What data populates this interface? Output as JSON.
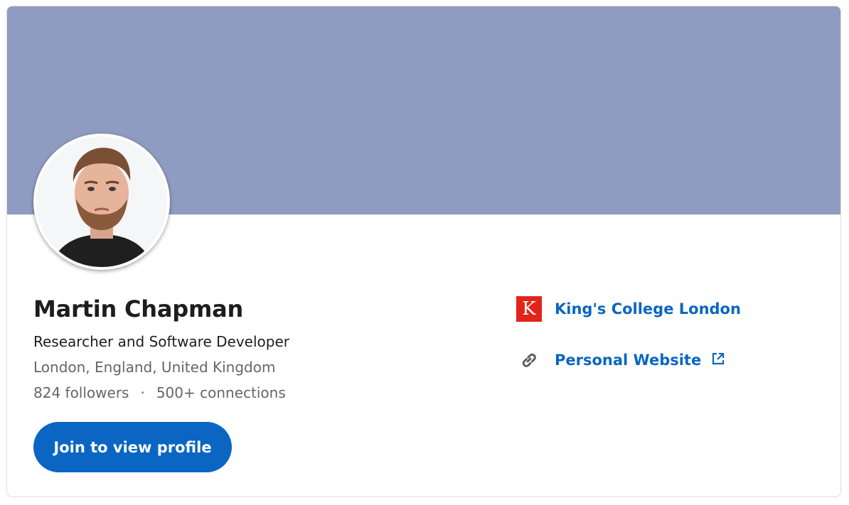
{
  "profile": {
    "name": "Martin Chapman",
    "headline": "Researcher and Software Developer",
    "location": "London, England, United Kingdom",
    "followers": "824 followers",
    "separator": "·",
    "connections": "500+ connections"
  },
  "actions": {
    "join_label": "Join to view profile"
  },
  "links": {
    "school": {
      "label": "King's College London",
      "logo_letter": "K",
      "logo_color": "#e2231a"
    },
    "website": {
      "label": "Personal Website",
      "icon": "link-icon",
      "external_icon": "external-link-icon"
    }
  },
  "theme": {
    "cover_color": "#8f9cc1",
    "accent": "#0a66c2"
  }
}
